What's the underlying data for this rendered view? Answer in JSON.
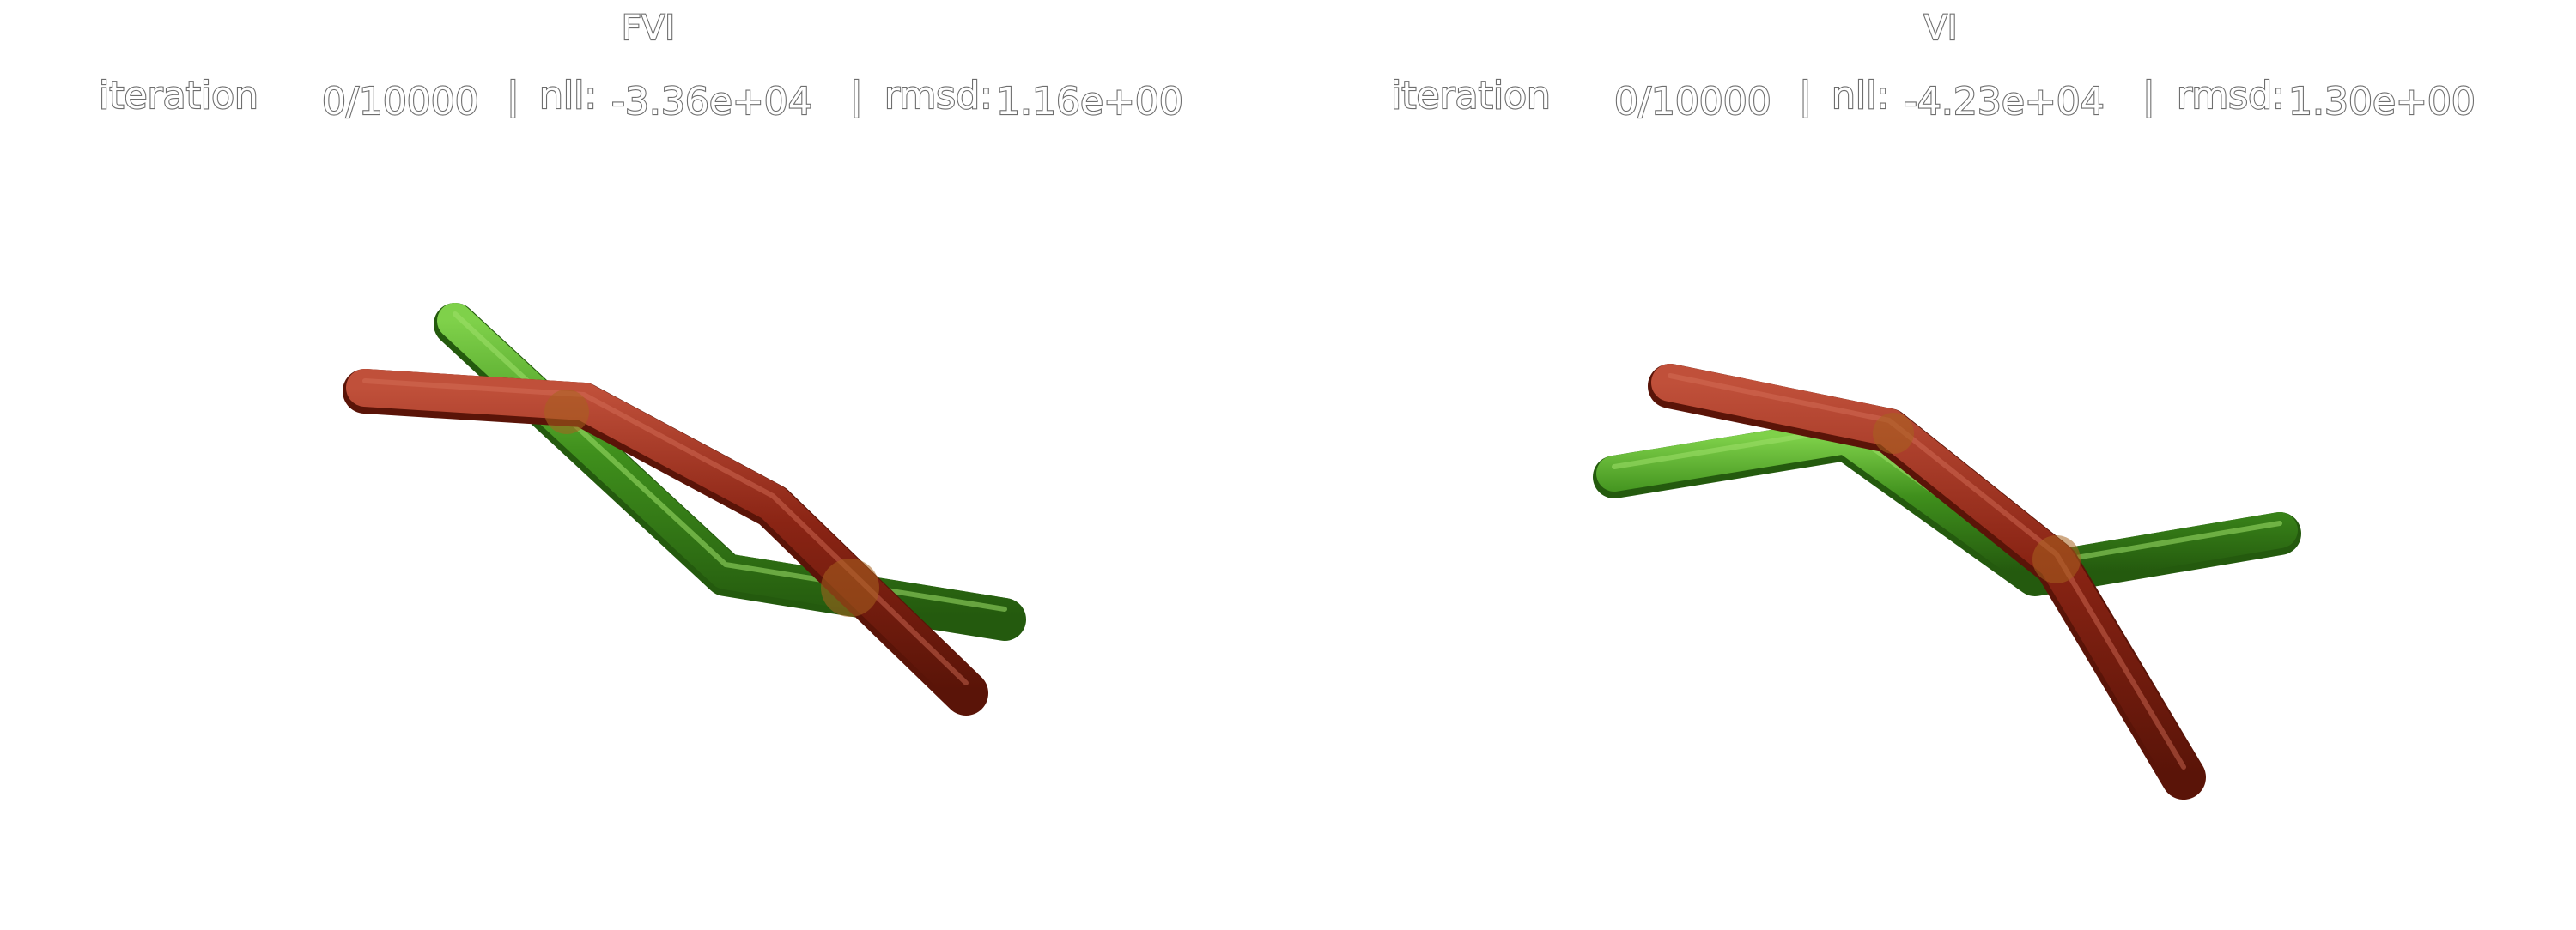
{
  "colors": {
    "background": "#ffffff",
    "text_outline": "#6e6e6e",
    "text_fill": "#ffffff",
    "green_structure": "#3f8f1c",
    "green_highlight": "#7fd14a",
    "green_shadow": "#245a0e",
    "red_structure": "#8a2414",
    "red_highlight": "#c0503a",
    "red_shadow": "#5a1408",
    "overlap": "#a8631f"
  },
  "panels": [
    {
      "title": "FVI",
      "iteration_label": "iteration",
      "iteration_value": "0/10000",
      "nll_label": "nll:",
      "nll_value": "-3.36e+04",
      "rmsd_label": "rmsd:",
      "rmsd_value": "1.16e+00"
    },
    {
      "title": "VI",
      "iteration_label": "iteration",
      "iteration_value": "0/10000",
      "nll_label": "nll:",
      "nll_value": "-4.23e+04",
      "rmsd_label": "rmsd:",
      "rmsd_value": "1.30e+00"
    }
  ],
  "separator": "|"
}
